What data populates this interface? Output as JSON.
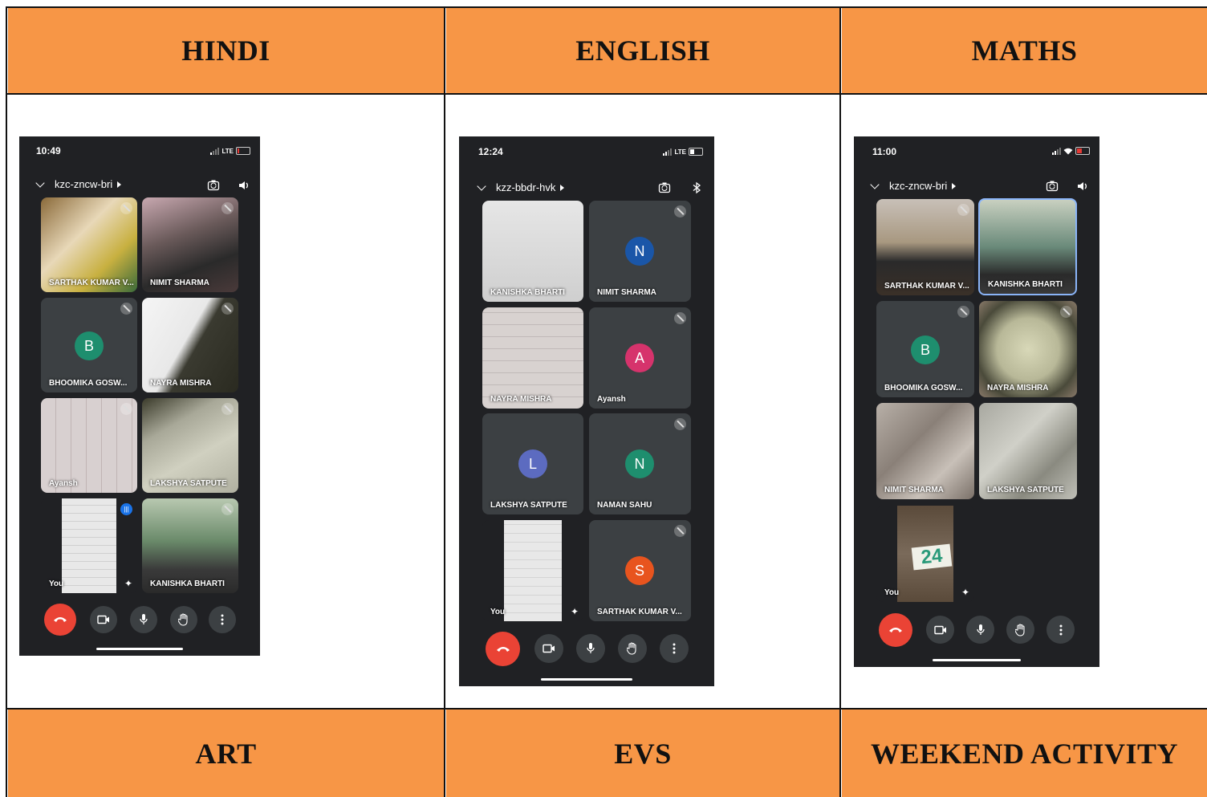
{
  "headers": {
    "hindi": "HINDI",
    "english": "ENGLISH",
    "maths": "MATHS",
    "art": "ART",
    "evs": "EVS",
    "weekend": "WEEKEND ACTIVITY"
  },
  "colors": {
    "header_bg": "#f79646",
    "meet_bg": "#202124",
    "end_call": "#ea4335"
  },
  "phones": [
    {
      "time": "10:49",
      "network": "LTE",
      "meeting_code": "kzc-zncw-bri",
      "participants": [
        {
          "name": "SARTHAK KUMAR V...",
          "muted": true,
          "type": "video"
        },
        {
          "name": "NIMIT SHARMA",
          "muted": true,
          "type": "video"
        },
        {
          "name": "BHOOMIKA GOSW...",
          "muted": true,
          "type": "avatar",
          "initial": "B",
          "color": "#1e8e6e"
        },
        {
          "name": "NAYRA MISHRA",
          "muted": true,
          "type": "video"
        },
        {
          "name": "Ayansh",
          "muted": true,
          "type": "video"
        },
        {
          "name": "LAKSHYA SATPUTE",
          "muted": true,
          "type": "video"
        },
        {
          "name": "You",
          "muted": false,
          "type": "video"
        },
        {
          "name": "KANISHKA BHARTI",
          "muted": true,
          "type": "video"
        }
      ]
    },
    {
      "time": "12:24",
      "network": "LTE",
      "meeting_code": "kzz-bbdr-hvk",
      "participants": [
        {
          "name": "KANISHKA BHARTI",
          "muted": false,
          "type": "video"
        },
        {
          "name": "NIMIT SHARMA",
          "muted": true,
          "type": "avatar",
          "initial": "N",
          "color": "#1a56a8"
        },
        {
          "name": "NAYRA MISHRA",
          "muted": false,
          "type": "video"
        },
        {
          "name": "Ayansh",
          "muted": true,
          "type": "avatar",
          "initial": "A",
          "color": "#d6336c"
        },
        {
          "name": "LAKSHYA SATPUTE",
          "muted": false,
          "type": "avatar",
          "initial": "L",
          "color": "#5c6bc0"
        },
        {
          "name": "NAMAN SAHU",
          "muted": true,
          "type": "avatar",
          "initial": "N",
          "color": "#1e8e6e"
        },
        {
          "name": "You",
          "muted": false,
          "type": "video"
        },
        {
          "name": "SARTHAK KUMAR V...",
          "muted": true,
          "type": "avatar",
          "initial": "S",
          "color": "#e8541e"
        }
      ]
    },
    {
      "time": "11:00",
      "meeting_code": "kzc-zncw-bri",
      "participants": [
        {
          "name": "SARTHAK KUMAR V...",
          "muted": true,
          "type": "video"
        },
        {
          "name": "KANISHKA BHARTI",
          "muted": false,
          "type": "video"
        },
        {
          "name": "BHOOMIKA GOSW...",
          "muted": true,
          "type": "avatar",
          "initial": "B",
          "color": "#1e8e6e"
        },
        {
          "name": "NAYRA MISHRA",
          "muted": true,
          "type": "video"
        },
        {
          "name": "NIMIT SHARMA",
          "muted": false,
          "type": "video"
        },
        {
          "name": "LAKSHYA SATPUTE",
          "muted": false,
          "type": "video"
        },
        {
          "name": "You",
          "muted": false,
          "type": "video"
        }
      ],
      "overlay_number": "24"
    }
  ]
}
